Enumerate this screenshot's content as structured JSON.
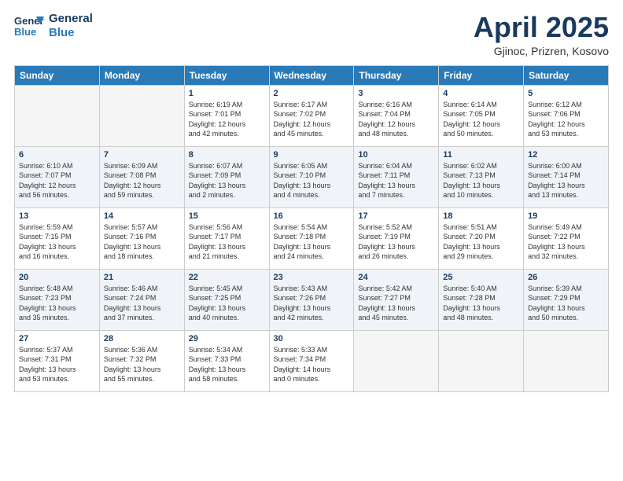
{
  "header": {
    "logo_line1": "General",
    "logo_line2": "Blue",
    "title": "April 2025",
    "location": "Gjinoc, Prizren, Kosovo"
  },
  "weekdays": [
    "Sunday",
    "Monday",
    "Tuesday",
    "Wednesday",
    "Thursday",
    "Friday",
    "Saturday"
  ],
  "weeks": [
    [
      {
        "day": "",
        "info": ""
      },
      {
        "day": "",
        "info": ""
      },
      {
        "day": "1",
        "info": "Sunrise: 6:19 AM\nSunset: 7:01 PM\nDaylight: 12 hours\nand 42 minutes."
      },
      {
        "day": "2",
        "info": "Sunrise: 6:17 AM\nSunset: 7:02 PM\nDaylight: 12 hours\nand 45 minutes."
      },
      {
        "day": "3",
        "info": "Sunrise: 6:16 AM\nSunset: 7:04 PM\nDaylight: 12 hours\nand 48 minutes."
      },
      {
        "day": "4",
        "info": "Sunrise: 6:14 AM\nSunset: 7:05 PM\nDaylight: 12 hours\nand 50 minutes."
      },
      {
        "day": "5",
        "info": "Sunrise: 6:12 AM\nSunset: 7:06 PM\nDaylight: 12 hours\nand 53 minutes."
      }
    ],
    [
      {
        "day": "6",
        "info": "Sunrise: 6:10 AM\nSunset: 7:07 PM\nDaylight: 12 hours\nand 56 minutes."
      },
      {
        "day": "7",
        "info": "Sunrise: 6:09 AM\nSunset: 7:08 PM\nDaylight: 12 hours\nand 59 minutes."
      },
      {
        "day": "8",
        "info": "Sunrise: 6:07 AM\nSunset: 7:09 PM\nDaylight: 13 hours\nand 2 minutes."
      },
      {
        "day": "9",
        "info": "Sunrise: 6:05 AM\nSunset: 7:10 PM\nDaylight: 13 hours\nand 4 minutes."
      },
      {
        "day": "10",
        "info": "Sunrise: 6:04 AM\nSunset: 7:11 PM\nDaylight: 13 hours\nand 7 minutes."
      },
      {
        "day": "11",
        "info": "Sunrise: 6:02 AM\nSunset: 7:13 PM\nDaylight: 13 hours\nand 10 minutes."
      },
      {
        "day": "12",
        "info": "Sunrise: 6:00 AM\nSunset: 7:14 PM\nDaylight: 13 hours\nand 13 minutes."
      }
    ],
    [
      {
        "day": "13",
        "info": "Sunrise: 5:59 AM\nSunset: 7:15 PM\nDaylight: 13 hours\nand 16 minutes."
      },
      {
        "day": "14",
        "info": "Sunrise: 5:57 AM\nSunset: 7:16 PM\nDaylight: 13 hours\nand 18 minutes."
      },
      {
        "day": "15",
        "info": "Sunrise: 5:56 AM\nSunset: 7:17 PM\nDaylight: 13 hours\nand 21 minutes."
      },
      {
        "day": "16",
        "info": "Sunrise: 5:54 AM\nSunset: 7:18 PM\nDaylight: 13 hours\nand 24 minutes."
      },
      {
        "day": "17",
        "info": "Sunrise: 5:52 AM\nSunset: 7:19 PM\nDaylight: 13 hours\nand 26 minutes."
      },
      {
        "day": "18",
        "info": "Sunrise: 5:51 AM\nSunset: 7:20 PM\nDaylight: 13 hours\nand 29 minutes."
      },
      {
        "day": "19",
        "info": "Sunrise: 5:49 AM\nSunset: 7:22 PM\nDaylight: 13 hours\nand 32 minutes."
      }
    ],
    [
      {
        "day": "20",
        "info": "Sunrise: 5:48 AM\nSunset: 7:23 PM\nDaylight: 13 hours\nand 35 minutes."
      },
      {
        "day": "21",
        "info": "Sunrise: 5:46 AM\nSunset: 7:24 PM\nDaylight: 13 hours\nand 37 minutes."
      },
      {
        "day": "22",
        "info": "Sunrise: 5:45 AM\nSunset: 7:25 PM\nDaylight: 13 hours\nand 40 minutes."
      },
      {
        "day": "23",
        "info": "Sunrise: 5:43 AM\nSunset: 7:26 PM\nDaylight: 13 hours\nand 42 minutes."
      },
      {
        "day": "24",
        "info": "Sunrise: 5:42 AM\nSunset: 7:27 PM\nDaylight: 13 hours\nand 45 minutes."
      },
      {
        "day": "25",
        "info": "Sunrise: 5:40 AM\nSunset: 7:28 PM\nDaylight: 13 hours\nand 48 minutes."
      },
      {
        "day": "26",
        "info": "Sunrise: 5:39 AM\nSunset: 7:29 PM\nDaylight: 13 hours\nand 50 minutes."
      }
    ],
    [
      {
        "day": "27",
        "info": "Sunrise: 5:37 AM\nSunset: 7:31 PM\nDaylight: 13 hours\nand 53 minutes."
      },
      {
        "day": "28",
        "info": "Sunrise: 5:36 AM\nSunset: 7:32 PM\nDaylight: 13 hours\nand 55 minutes."
      },
      {
        "day": "29",
        "info": "Sunrise: 5:34 AM\nSunset: 7:33 PM\nDaylight: 13 hours\nand 58 minutes."
      },
      {
        "day": "30",
        "info": "Sunrise: 5:33 AM\nSunset: 7:34 PM\nDaylight: 14 hours\nand 0 minutes."
      },
      {
        "day": "",
        "info": ""
      },
      {
        "day": "",
        "info": ""
      },
      {
        "day": "",
        "info": ""
      }
    ]
  ]
}
